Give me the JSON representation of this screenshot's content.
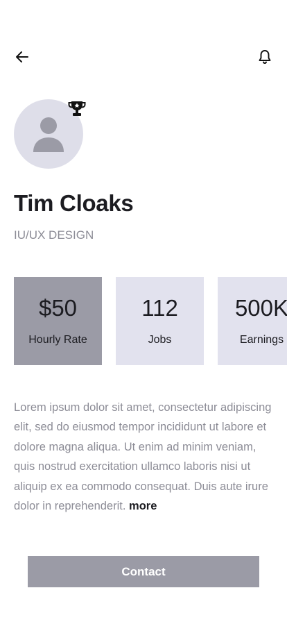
{
  "header": {
    "back_icon": "arrow-left-icon",
    "notification_icon": "bell-icon"
  },
  "profile": {
    "avatar_icon": "user-placeholder-icon",
    "badge_icon": "trophy-icon",
    "name": "Tim Cloaks",
    "role": "IU/UX DESIGN"
  },
  "stats": [
    {
      "value": "$50",
      "label": "Hourly Rate"
    },
    {
      "value": "112",
      "label": "Jobs"
    },
    {
      "value": "500K",
      "label": "Earnings"
    }
  ],
  "description": {
    "text": "Lorem ipsum dolor sit amet, consectetur adipiscing elit, sed do eiusmod tempor incididunt ut labore et dolore magna aliqua. Ut enim ad minim veniam, quis nostrud exercitation ullamco laboris nisi ut aliquip ex ea commodo consequat. Duis aute irure dolor in reprehenderit.",
    "more_label": "more"
  },
  "actions": {
    "contact_label": "Contact"
  },
  "colors": {
    "active_card": "#9b9ba6",
    "inactive_card": "#e2e2ee",
    "avatar_bg": "#dedee9",
    "muted_text": "#8c8c96",
    "primary_text": "#1c1c21"
  }
}
